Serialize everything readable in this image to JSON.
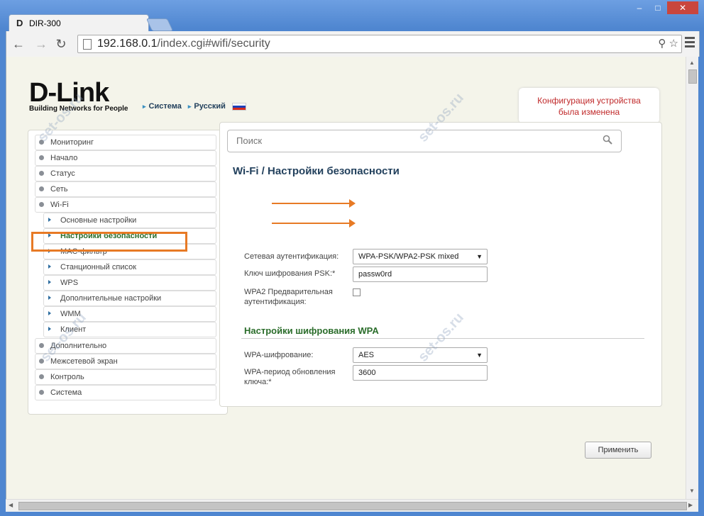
{
  "browser": {
    "tab_title": "DIR-300",
    "tab_logo": "D",
    "url_host": "192.168.0.1",
    "url_path": "/index.cgi#wifi/security",
    "icons": [
      "back-icon",
      "forward-icon",
      "reload-icon",
      "search-icon",
      "star-icon",
      "menu-icon"
    ]
  },
  "brand": {
    "logo_text": "D-Link",
    "tagline": "Building Networks for People"
  },
  "top_nav": {
    "system": "Система",
    "language": "Русский"
  },
  "notification": {
    "line1": "Конфигурация устройства",
    "line2": "была изменена",
    "count": "2"
  },
  "search": {
    "placeholder": "Поиск"
  },
  "sidebar": {
    "items": [
      {
        "label": "Мониторинг",
        "sub": false
      },
      {
        "label": "Начало",
        "sub": false
      },
      {
        "label": "Статус",
        "sub": false
      },
      {
        "label": "Сеть",
        "sub": false
      },
      {
        "label": "Wi-Fi",
        "sub": false
      },
      {
        "label": "Основные настройки",
        "sub": true
      },
      {
        "label": "Настройки безопасности",
        "sub": true,
        "active": true
      },
      {
        "label": "MAC-фильтр",
        "sub": true
      },
      {
        "label": "Станционный список",
        "sub": true
      },
      {
        "label": "WPS",
        "sub": true
      },
      {
        "label": "Дополнительные настройки",
        "sub": true
      },
      {
        "label": "WMM",
        "sub": true
      },
      {
        "label": "Клиент",
        "sub": true
      },
      {
        "label": "Дополнительно",
        "sub": false
      },
      {
        "label": "Межсетевой экран",
        "sub": false
      },
      {
        "label": "Контроль",
        "sub": false
      },
      {
        "label": "Система",
        "sub": false
      }
    ]
  },
  "main": {
    "title": "Wi-Fi /  Настройки безопасности",
    "auth_label": "Сетевая аутентификация:",
    "auth_value": "WPA-PSK/WPA2-PSK mixed",
    "psk_label": "Ключ шифрования PSK:*",
    "psk_value": "passw0rd",
    "preauth_label_1": "WPA2 Предварительная",
    "preauth_label_2": "аутентификация:",
    "preauth_checked": false,
    "wpa_section": "Настройки шифрования WPA",
    "cipher_label": "WPA-шифрование:",
    "cipher_value": "AES",
    "rekey_label_1": "WPA-период обновления",
    "rekey_label_2": "ключа:*",
    "rekey_value": "3600",
    "apply": "Применить"
  },
  "watermark": "set-os.ru",
  "colors": {
    "accent_orange": "#e77a25",
    "alert_red": "#c0292a",
    "section_green": "#2b6d2b",
    "title_blue": "#23415d"
  }
}
